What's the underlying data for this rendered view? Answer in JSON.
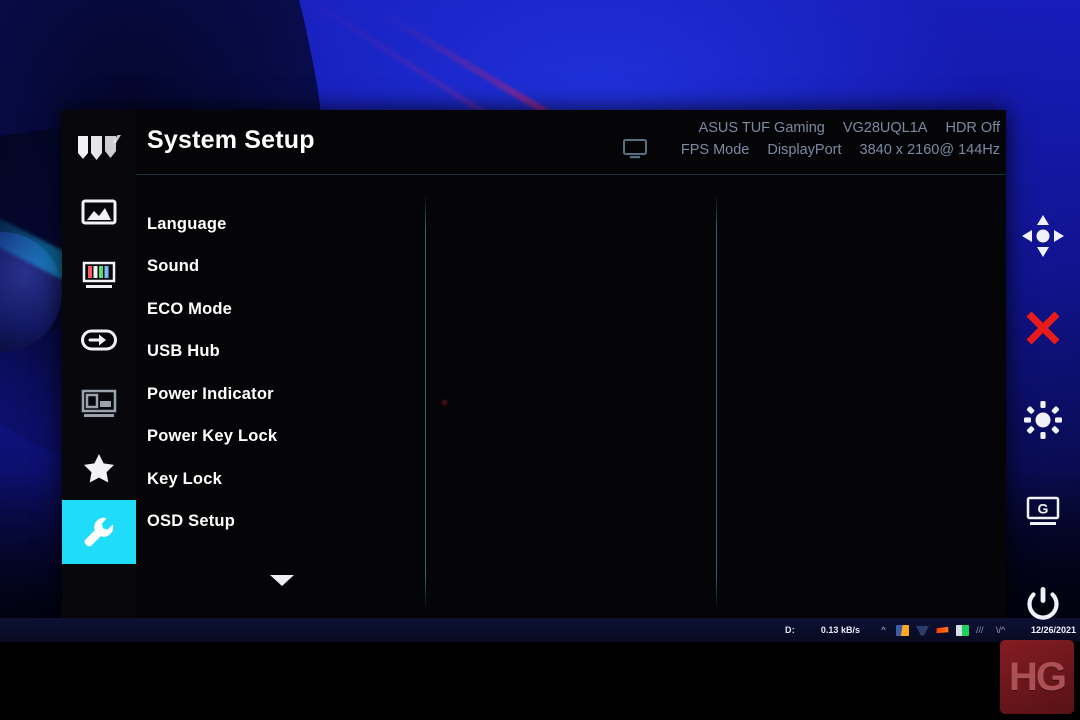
{
  "osd": {
    "title": "System Setup",
    "header": {
      "monitor_icon": "display-icon",
      "brand": "ASUS TUF Gaming",
      "model": "VG28UQL1A",
      "hdr_status": "HDR Off",
      "preset_mode": "FPS Mode",
      "input_source": "DisplayPort",
      "resolution": "3840 x 2160@ 144Hz"
    },
    "rail": [
      {
        "name": "tuf-logo-icon",
        "label": "TUF Gaming",
        "active": false
      },
      {
        "name": "gaming-image-icon",
        "label": "Gaming",
        "active": false
      },
      {
        "name": "color-bars-icon",
        "label": "Image",
        "active": false
      },
      {
        "name": "input-source-icon",
        "label": "Input Select",
        "active": false
      },
      {
        "name": "pip-pbp-icon",
        "label": "PIP/PBP Setting",
        "active": false
      },
      {
        "name": "star-shortcut-icon",
        "label": "MyFavorite",
        "active": false
      },
      {
        "name": "wrench-settings-icon",
        "label": "System Setup",
        "active": true
      }
    ],
    "menu_items": [
      "Language",
      "Sound",
      "ECO Mode",
      "USB Hub",
      "Power Indicator",
      "Power Key Lock",
      "Key Lock",
      "OSD Setup"
    ],
    "scroll_indicator": "chevron-down-icon"
  },
  "controls": [
    {
      "name": "navigation-joystick-icon",
      "label": "Navigate",
      "color": "#f0f2f8"
    },
    {
      "name": "close-x-icon",
      "label": "Close",
      "color": "#e81b1b"
    },
    {
      "name": "brightness-sun-icon",
      "label": "Brightness",
      "color": "#f0f2f8"
    },
    {
      "name": "gamevisual-g-icon",
      "label": "GameVisual",
      "color": "#f0f2f8"
    },
    {
      "name": "power-icon",
      "label": "Power",
      "color": "#f0f2f8"
    }
  ],
  "taskbar": {
    "drive_label": "D:",
    "network_speed": "0.13 kB/s",
    "tray_overflow": "^",
    "tray_icons": [
      "app-folder-icon",
      "triangle-icon",
      "flame-icon",
      "monitor-green-icon",
      "waveform-icon",
      "network-icon"
    ],
    "date": "12/26/2021"
  },
  "watermark": {
    "text": "HG",
    "color": "#8f2026"
  },
  "colors": {
    "accent_cyan": "#1fdcfb",
    "panel_bg": "#050508",
    "close_red": "#e81b1b",
    "divider": "#34788 7",
    "header_text": "#7b8aa0",
    "wallpaper_blue": "#1b22c8"
  }
}
